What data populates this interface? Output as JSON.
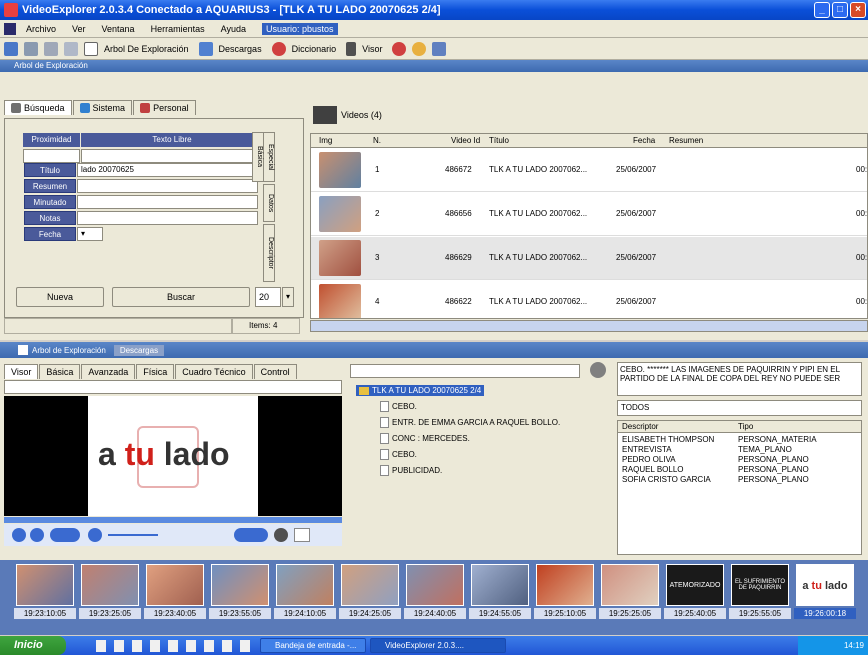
{
  "window": {
    "title": "VideoExplorer 2.0.3.4 Conectado a AQUARIUS3 - [TLK A TU LADO 20070625 2/4]"
  },
  "menu": {
    "items": [
      "Archivo",
      "Ver",
      "Ventana",
      "Herramientas",
      "Ayuda"
    ],
    "user": "Usuario: pbustos"
  },
  "toolbar": {
    "arbol": "Arbol De Exploración",
    "descargas": "Descargas",
    "diccionario": "Diccionario",
    "visor": "Visor"
  },
  "panel": {
    "title": "Arbol de Exploración"
  },
  "search": {
    "tabs": [
      "Búsqueda",
      "Sistema",
      "Personal"
    ],
    "header_left": "Proximidad",
    "header_right": "Texto Libre",
    "fields": [
      "Título",
      "Resumen",
      "Minutado",
      "Notas",
      "Fecha"
    ],
    "titulo_value": "lado 20070625",
    "vtabs": [
      "Especial",
      "Básica",
      "Datos",
      "Descriptor"
    ],
    "nueva": "Nueva",
    "buscar": "Buscar",
    "count": "20",
    "items": "Items: 4"
  },
  "videos": {
    "tab": "Videos (4)",
    "columns": [
      "Img",
      "N.",
      "Video Id",
      "Título",
      "Fecha",
      "Resumen"
    ],
    "rows": [
      {
        "n": "1",
        "id": "486672",
        "titulo": "TLK A TU LADO 2007062...",
        "fecha": "25/06/2007",
        "dur": "00:"
      },
      {
        "n": "2",
        "id": "486656",
        "titulo": "TLK A TU LADO 2007062...",
        "fecha": "25/06/2007",
        "dur": "00:"
      },
      {
        "n": "3",
        "id": "486629",
        "titulo": "TLK A TU LADO 2007062...",
        "fecha": "25/06/2007",
        "dur": "00:"
      },
      {
        "n": "4",
        "id": "486622",
        "titulo": "TLK A TU LADO 2007062...",
        "fecha": "25/06/2007",
        "dur": "00:"
      }
    ]
  },
  "bottom": {
    "tabs": [
      "Arbol de Exploración",
      "Descargas"
    ],
    "visor_tabs": [
      "Visor",
      "Básica",
      "Avanzada",
      "Física",
      "Cuadro Técnico",
      "Control"
    ],
    "logo": {
      "a": "a",
      "tu": "tu",
      "lado": "lado"
    },
    "tree_root": "TLK A TU LADO 20070625 2/4",
    "tree_items": [
      "CEBO.",
      "ENTR. DE EMMA GARCIA A RAQUEL BOLLO.",
      "CONC : MERCEDES.",
      "CEBO.",
      "PUBLICIDAD."
    ],
    "desc_text": "CEBO. ******* LAS IMAGENES DE PAQUIRRIN Y PIPI EN EL PARTIDO DE LA FINAL DE COPA DEL REY NO PUEDE SER",
    "filter": "TODOS",
    "table_headers": [
      "Descriptor",
      "Tipo"
    ],
    "table_rows": [
      [
        "ELISABETH THOMPSON",
        "PERSONA_MATERIA"
      ],
      [
        "ENTREVISTA",
        "TEMA_PLANO"
      ],
      [
        "PEDRO OLIVA",
        "PERSONA_PLANO"
      ],
      [
        "RAQUEL BOLLO",
        "PERSONA_PLANO"
      ],
      [
        "SOFIA CRISTO GARCIA",
        "PERSONA_PLANO"
      ]
    ]
  },
  "strip": {
    "times": [
      "19:23:10:05",
      "19:23:25:05",
      "19:23:40:05",
      "19:23:55:05",
      "19:24:10:05",
      "19:24:25:05",
      "19:24:40:05",
      "19:24:55:05",
      "19:25:10:05",
      "19:25:25:05",
      "19:25:40:05",
      "19:25:55:05",
      "19:26:00:18"
    ],
    "thumb_labels": {
      "t10": "ATEMORIZADO",
      "t11a": "EL SUFRIMIENTO",
      "t11b": "DE PAQUIRRIN"
    }
  },
  "taskbar": {
    "start": "Inicio",
    "tasks": [
      "Bandeja de entrada -...",
      "VideoExplorer 2.0.3...."
    ],
    "clock": "14:19"
  }
}
